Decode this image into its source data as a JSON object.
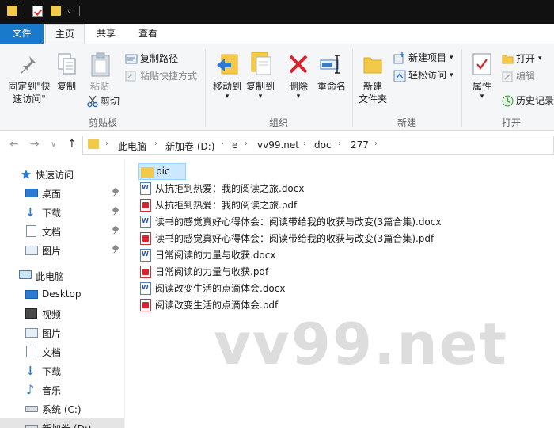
{
  "ribbon_tabs": {
    "file": "文件",
    "home": "主页",
    "share": "共享",
    "view": "查看"
  },
  "clipboard": {
    "pin_line1": "固定到\"快",
    "pin_line2": "速访问\"",
    "copy": "复制",
    "paste": "粘贴",
    "copy_path": "复制路径",
    "paste_shortcut": "粘贴快捷方式",
    "cut": "剪切",
    "group": "剪贴板"
  },
  "organize": {
    "move_to": "移动到",
    "copy_to": "复制到",
    "delete": "删除",
    "rename": "重命名",
    "group": "组织"
  },
  "new_group": {
    "new_folder_line1": "新建",
    "new_folder_line2": "文件夹",
    "new_item": "新建项目",
    "easy_access": "轻松访问",
    "group": "新建"
  },
  "open_group": {
    "properties": "属性",
    "open": "打开",
    "edit": "编辑",
    "history": "历史记录",
    "group": "打开"
  },
  "breadcrumb": [
    "此电脑",
    "新加卷 (D:)",
    "e",
    "vv99.net",
    "doc",
    "277"
  ],
  "nav": {
    "quick_access": "快速访问",
    "desktop_pinned": "桌面",
    "downloads_pinned": "下载",
    "documents_pinned": "文档",
    "pictures_pinned": "图片",
    "this_pc": "此电脑",
    "desktop": "Desktop",
    "videos": "视频",
    "pictures": "图片",
    "documents": "文档",
    "downloads": "下载",
    "music": "音乐",
    "system_c": "系统 (C:)",
    "new_volume_d": "新加卷 (D:)"
  },
  "files": [
    {
      "name": "pic",
      "type": "folder"
    },
    {
      "name": "从抗拒到热爱：我的阅读之旅.docx",
      "type": "docx"
    },
    {
      "name": "从抗拒到热爱：我的阅读之旅.pdf",
      "type": "pdf"
    },
    {
      "name": "读书的感觉真好心得体会：阅读带给我的收获与改变(3篇合集).docx",
      "type": "docx"
    },
    {
      "name": "读书的感觉真好心得体会：阅读带给我的收获与改变(3篇合集).pdf",
      "type": "pdf"
    },
    {
      "name": "日常阅读的力量与收获.docx",
      "type": "docx"
    },
    {
      "name": "日常阅读的力量与收获.pdf",
      "type": "pdf"
    },
    {
      "name": "阅读改变生活的点滴体会.docx",
      "type": "docx"
    },
    {
      "name": "阅读改变生活的点滴体会.pdf",
      "type": "pdf"
    }
  ],
  "watermark": "vv99.net",
  "colors": {
    "accent": "#1979ca",
    "folder": "#f3c94a",
    "selection": "#cce8ff",
    "delete_red": "#d9232e"
  }
}
